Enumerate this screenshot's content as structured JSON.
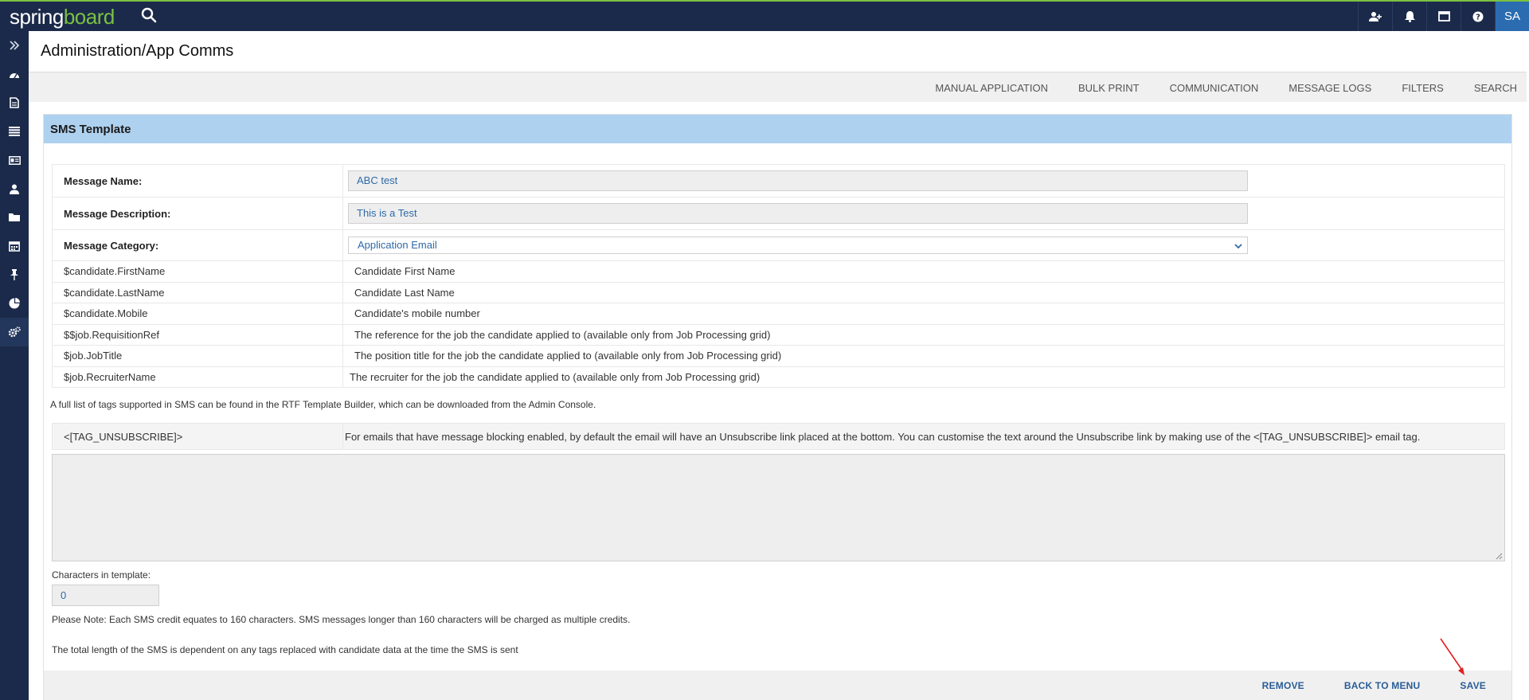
{
  "app": {
    "logo_text_white": "spring",
    "logo_text_green": "board",
    "avatar_initials": "SA"
  },
  "page": {
    "title": "Administration/App Comms"
  },
  "subnav": [
    "MANUAL APPLICATION",
    "BULK PRINT",
    "COMMUNICATION",
    "MESSAGE LOGS",
    "FILTERS",
    "SEARCH"
  ],
  "panel": {
    "title": "SMS Template"
  },
  "form": {
    "name_label": "Message Name:",
    "name_value": "ABC test",
    "desc_label": "Message Description:",
    "desc_value": "This is a Test",
    "category_label": "Message Category:",
    "category_value": "Application Email"
  },
  "tags": [
    {
      "tag": "$candidate.FirstName",
      "desc": "Candidate First Name"
    },
    {
      "tag": "$candidate.LastName",
      "desc": "Candidate Last Name"
    },
    {
      "tag": "$candidate.Mobile",
      "desc": "Candidate's mobile number"
    },
    {
      "tag": "$$job.RequisitionRef",
      "desc": "The reference for the job the candidate applied to (available only from Job Processing grid)"
    },
    {
      "tag": "$job.JobTitle",
      "desc": "The position title for the job the candidate applied to (available only from Job Processing grid)"
    },
    {
      "tag": "$job.RecruiterName",
      "desc": "The recruiter for the job the candidate applied to (available only from Job Processing grid)"
    }
  ],
  "note_full_list": "A full list of tags supported in SMS can be found in the RTF Template Builder, which can be downloaded from the Admin Console.",
  "unsubscribe": {
    "tag": "<[TAG_UNSUBSCRIBE]>",
    "desc": " For emails that have message blocking enabled, by default the email will have an Unsubscribe link placed at the bottom. You can customise the text around the Unsubscribe link by making use of the <[TAG_UNSUBSCRIBE]> email tag."
  },
  "characters": {
    "label": "Characters in template:",
    "value": "0"
  },
  "note_credit": "Please Note: Each SMS credit equates to 160 characters. SMS messages longer than 160 characters will be charged as multiple credits.",
  "note_length": "The total length of the SMS is dependent on any tags replaced with candidate data at the time the SMS is sent",
  "footer": {
    "remove": "REMOVE",
    "back": "BACK TO MENU",
    "save": "SAVE"
  },
  "colors": {
    "topbar": "#1b2a4a",
    "accent_green": "#7ac142",
    "panel_header": "#aed1ef",
    "link_blue": "#2a5d97",
    "annotation_arrow": "#e02020"
  },
  "icons": {
    "top": [
      "add-user-icon",
      "bell-icon",
      "window-icon",
      "help-icon"
    ],
    "sidebar": [
      "expand-icon",
      "dashboard-icon",
      "document-icon",
      "list-icon",
      "id-card-icon",
      "user-icon",
      "folder-icon",
      "calendar-icon",
      "pin-icon",
      "pie-chart-icon",
      "gears-icon"
    ]
  }
}
